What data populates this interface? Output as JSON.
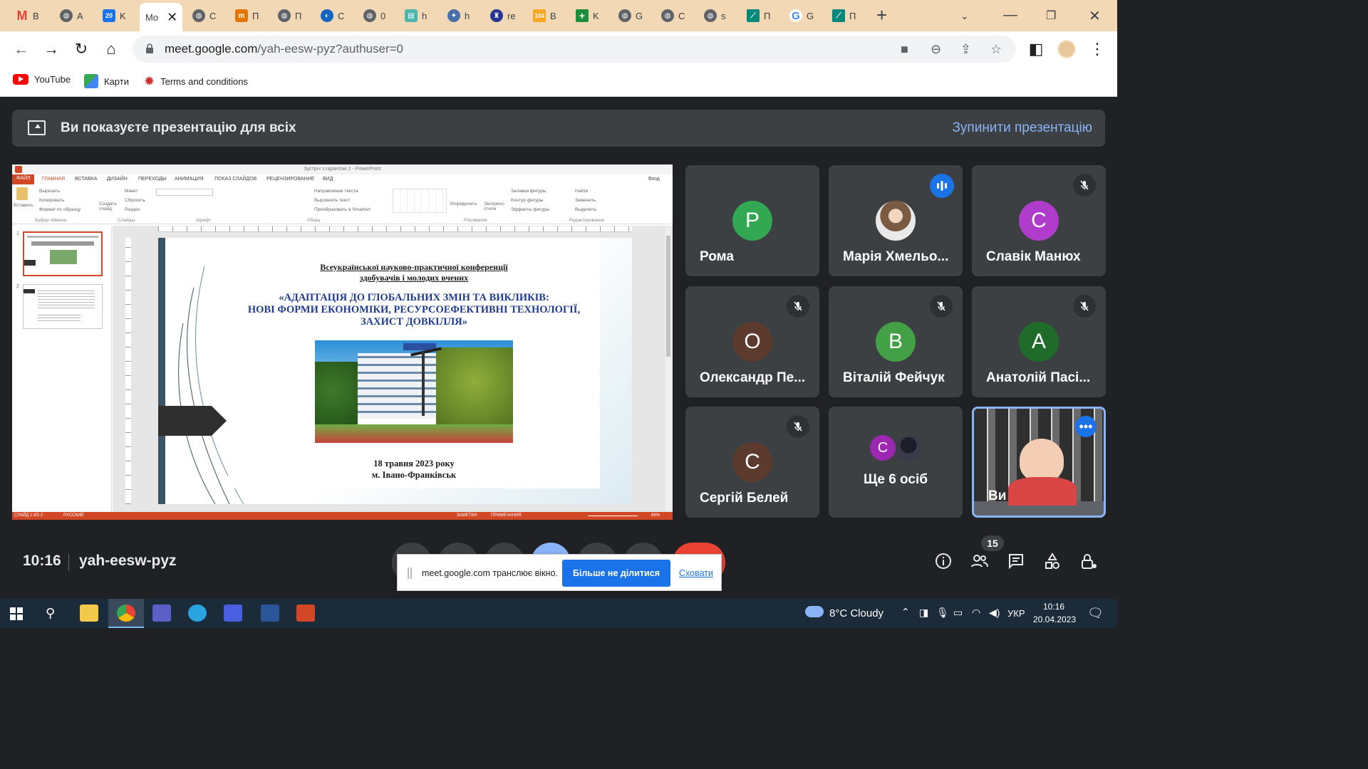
{
  "browser": {
    "tabs": [
      {
        "title": "B",
        "favicon": "gmail-icon",
        "color": "#ea4335"
      },
      {
        "title": "A",
        "favicon": "globe-icon",
        "color": "#5f6368"
      },
      {
        "title": "K",
        "favicon": "calendar-icon",
        "color": "#1a73e8"
      },
      {
        "title": "Mo",
        "favicon": "meet-icon",
        "color": "#00897b",
        "active": true
      },
      {
        "title": "C",
        "favicon": "globe-icon",
        "color": "#5f6368"
      },
      {
        "title": "П",
        "favicon": "flag-icon",
        "color": "#e37400"
      },
      {
        "title": "П",
        "favicon": "globe-icon",
        "color": "#5f6368"
      },
      {
        "title": "C",
        "favicon": "orb-icon",
        "color": "#1565c0"
      },
      {
        "title": "0",
        "favicon": "globe-icon",
        "color": "#5f6368"
      },
      {
        "title": "h",
        "favicon": "book-icon",
        "color": "#4db6ac"
      },
      {
        "title": "h",
        "favicon": "emblem-icon",
        "color": "#4a6fa5"
      },
      {
        "title": "re",
        "favicon": "shield-icon",
        "color": "#283593"
      },
      {
        "title": "B",
        "favicon": "news-icon",
        "color": "#f9a825"
      },
      {
        "title": "K",
        "favicon": "plus-cross-icon",
        "color": "#1e8e3e"
      },
      {
        "title": "G",
        "favicon": "globe-icon",
        "color": "#5f6368"
      },
      {
        "title": "C",
        "favicon": "globe-icon",
        "color": "#5f6368"
      },
      {
        "title": "s",
        "favicon": "globe-icon",
        "color": "#5f6368"
      },
      {
        "title": "П",
        "favicon": "chart-icon",
        "color": "#00897b"
      },
      {
        "title": "G",
        "favicon": "google-icon",
        "color": "#4285f4"
      },
      {
        "title": "П",
        "favicon": "chart-icon",
        "color": "#00897b"
      }
    ],
    "url_host": "meet.google.com",
    "url_path": "/yah-eesw-pyz?authuser=0",
    "bookmarks": [
      {
        "label": "YouTube",
        "icon": "youtube-icon"
      },
      {
        "label": "Карти",
        "icon": "maps-icon"
      },
      {
        "label": "Terms and conditions",
        "icon": "maple-leaf-icon"
      }
    ]
  },
  "presentation_banner": {
    "text": "Ви показуєте презентацію для всіх",
    "stop_label": "Зупинити презентацію"
  },
  "ppt": {
    "window_title": "Зустріч з гарантом 2 - PowerPoint",
    "tabs": [
      "ФАЙЛ",
      "ГЛАВНАЯ",
      "ВСТАВКА",
      "ДИЗАЙН",
      "ПЕРЕХОДЫ",
      "АНИМАЦИЯ",
      "ПОКАЗ СЛАЙДОВ",
      "РЕЦЕНЗИРОВАНИЕ",
      "ВИД"
    ],
    "signin": "Вход",
    "ribbon": {
      "paste": "Вставить",
      "cut": "Вырезать",
      "copy": "Копировать",
      "format": "Формат по образцу",
      "clipboard": "Буфер обмена",
      "create_slide": "Создать слайд",
      "layout": "Макет",
      "reset": "Сбросить",
      "section": "Раздел",
      "slides": "Слайды",
      "font": "Шрифт",
      "paragraph": "Абзац",
      "text_direction": "Направление текста",
      "align_text": "Выровнять текст",
      "smartart": "Преобразовать в SmartArt",
      "arrange": "Упорядочить",
      "quick_styles": "Экспресс-стили",
      "shape_fill": "Заливка фигуры",
      "shape_outline": "Контур фигуры",
      "shape_effects": "Эффекты фигуры",
      "drawing": "Рисование",
      "find": "Найти",
      "replace": "Заменить",
      "select": "Выделить",
      "editing": "Редактирование"
    },
    "slide_numbers": [
      "1",
      "2"
    ],
    "slide": {
      "line1": "Всеукраїнської науково-практичної конференції",
      "line2": "здобувачів і молодих вчених",
      "title1": "«АДАПТАЦІЯ ДО ГЛОБАЛЬНИХ ЗМІН ТА ВИКЛИКІВ:",
      "title2": "НОВІ ФОРМИ ЕКОНОМІКИ, РЕСУРСОЕФЕКТИВНІ ТЕХНОЛОГІЇ,",
      "title3": "ЗАХИСТ ДОВКІЛЛЯ»",
      "date": "18 травня 2023 року",
      "city": "м. Івано-Франківськ"
    },
    "status": {
      "slide_of": "СЛАЙД 1 ИЗ 2",
      "language": "РУССКИЙ",
      "notes": "ЗАМЕТКИ",
      "comments": "ПРИМЕЧАНИЯ",
      "zoom": "86%"
    }
  },
  "participants": [
    {
      "name": "Рома",
      "initial": "Р",
      "color": "#33a852",
      "mic": "none"
    },
    {
      "name": "Марія Хмельо...",
      "initial": "",
      "color": "#c9a88a",
      "mic": "speaking"
    },
    {
      "name": "Славік Манюх",
      "initial": "С",
      "color": "#b03ccb",
      "mic": "muted"
    },
    {
      "name": "Олександр Пе...",
      "initial": "О",
      "color": "#5d3a2e",
      "mic": "muted"
    },
    {
      "name": "Віталій Фейчук",
      "initial": "В",
      "color": "#43a047",
      "mic": "muted"
    },
    {
      "name": "Анатолій Пасі...",
      "initial": "А",
      "color": "#1e6b2a",
      "mic": "muted"
    },
    {
      "name": "Сергій Белей",
      "initial": "С",
      "color": "#5d3a2e",
      "mic": "muted"
    },
    {
      "name": "Ще 6 осіб",
      "initial": "С",
      "color": "#9c27b0",
      "mic": "none"
    },
    {
      "name": "Ви",
      "initial": "",
      "color": "#4a4a4a",
      "mic": "more"
    }
  ],
  "meeting": {
    "time": "10:16",
    "code": "yah-eesw-pyz",
    "participant_count": "15"
  },
  "share_notice": {
    "text": "meet.google.com транслює вікно.",
    "stop_label": "Більше не ділитися",
    "hide_label": "Сховати"
  },
  "taskbar": {
    "weather": "8°C Cloudy",
    "language": "УКР",
    "time": "10:16",
    "date": "20.04.2023"
  }
}
